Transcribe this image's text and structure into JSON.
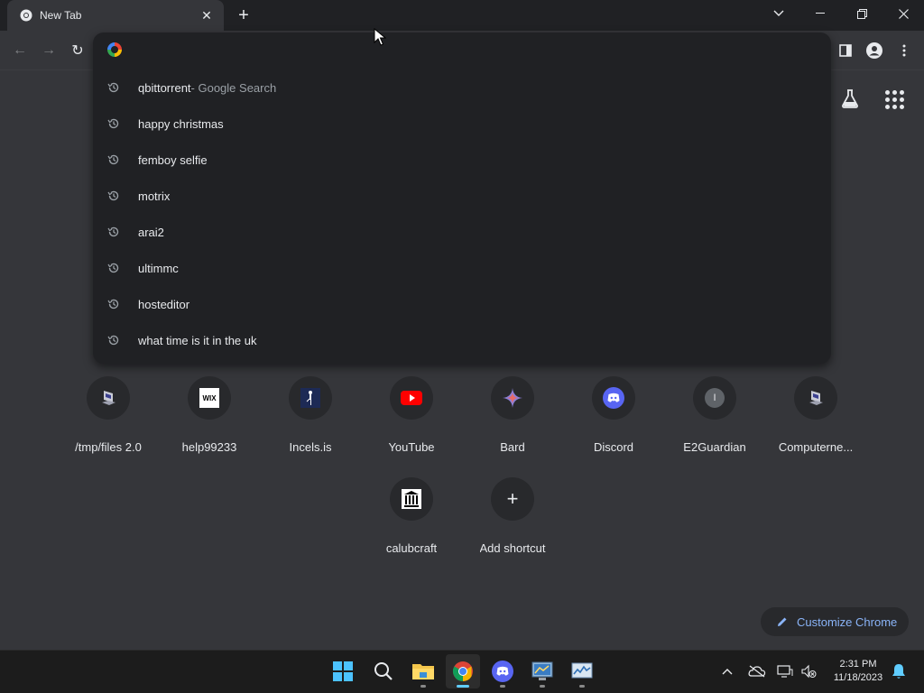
{
  "tab": {
    "title": "New Tab",
    "close": "✕",
    "new_tab": "+"
  },
  "window": {
    "chevron": "⌄",
    "minimize": "—",
    "restore": "❐",
    "close": "✕"
  },
  "toolbar": {
    "back": "←",
    "forward": "→",
    "reload": "↻"
  },
  "omnibox": {
    "value": "",
    "suggestions": [
      {
        "text": "qbittorrent",
        "sub": " - Google Search"
      },
      {
        "text": "happy christmas",
        "sub": ""
      },
      {
        "text": "femboy selfie",
        "sub": ""
      },
      {
        "text": "motrix",
        "sub": ""
      },
      {
        "text": "arai2",
        "sub": ""
      },
      {
        "text": "ultimmc",
        "sub": ""
      },
      {
        "text": "hosteditor",
        "sub": ""
      },
      {
        "text": "what time is it in the uk",
        "sub": ""
      }
    ]
  },
  "shortcuts": [
    {
      "label": "/tmp/files 2.0",
      "icon": "computer-icon"
    },
    {
      "label": "help99233",
      "icon": "wix-icon",
      "glyph": "WIX"
    },
    {
      "label": "Incels.is",
      "icon": "incels-icon"
    },
    {
      "label": "YouTube",
      "icon": "youtube-icon"
    },
    {
      "label": "Bard",
      "icon": "bard-icon"
    },
    {
      "label": "Discord",
      "icon": "discord-icon"
    },
    {
      "label": "E2Guardian",
      "icon": "e2guardian-icon",
      "glyph": "I"
    },
    {
      "label": "Computerne...",
      "icon": "computer-icon"
    },
    {
      "label": "calubcraft",
      "icon": "bank-icon"
    },
    {
      "label": "Add shortcut",
      "icon": "plus-icon",
      "glyph": "+"
    }
  ],
  "customize": {
    "label": "Customize Chrome"
  },
  "taskbar": {
    "apps": [
      "start-icon",
      "search-icon",
      "file-explorer-icon",
      "chrome-icon",
      "discord-icon",
      "control-panel-icon",
      "task-manager-icon"
    ],
    "clock": {
      "time": "2:31 PM",
      "date": "11/18/2023"
    }
  },
  "colors": {
    "accent": "#8ab4f8",
    "taskbar_active": "#60cdff"
  }
}
